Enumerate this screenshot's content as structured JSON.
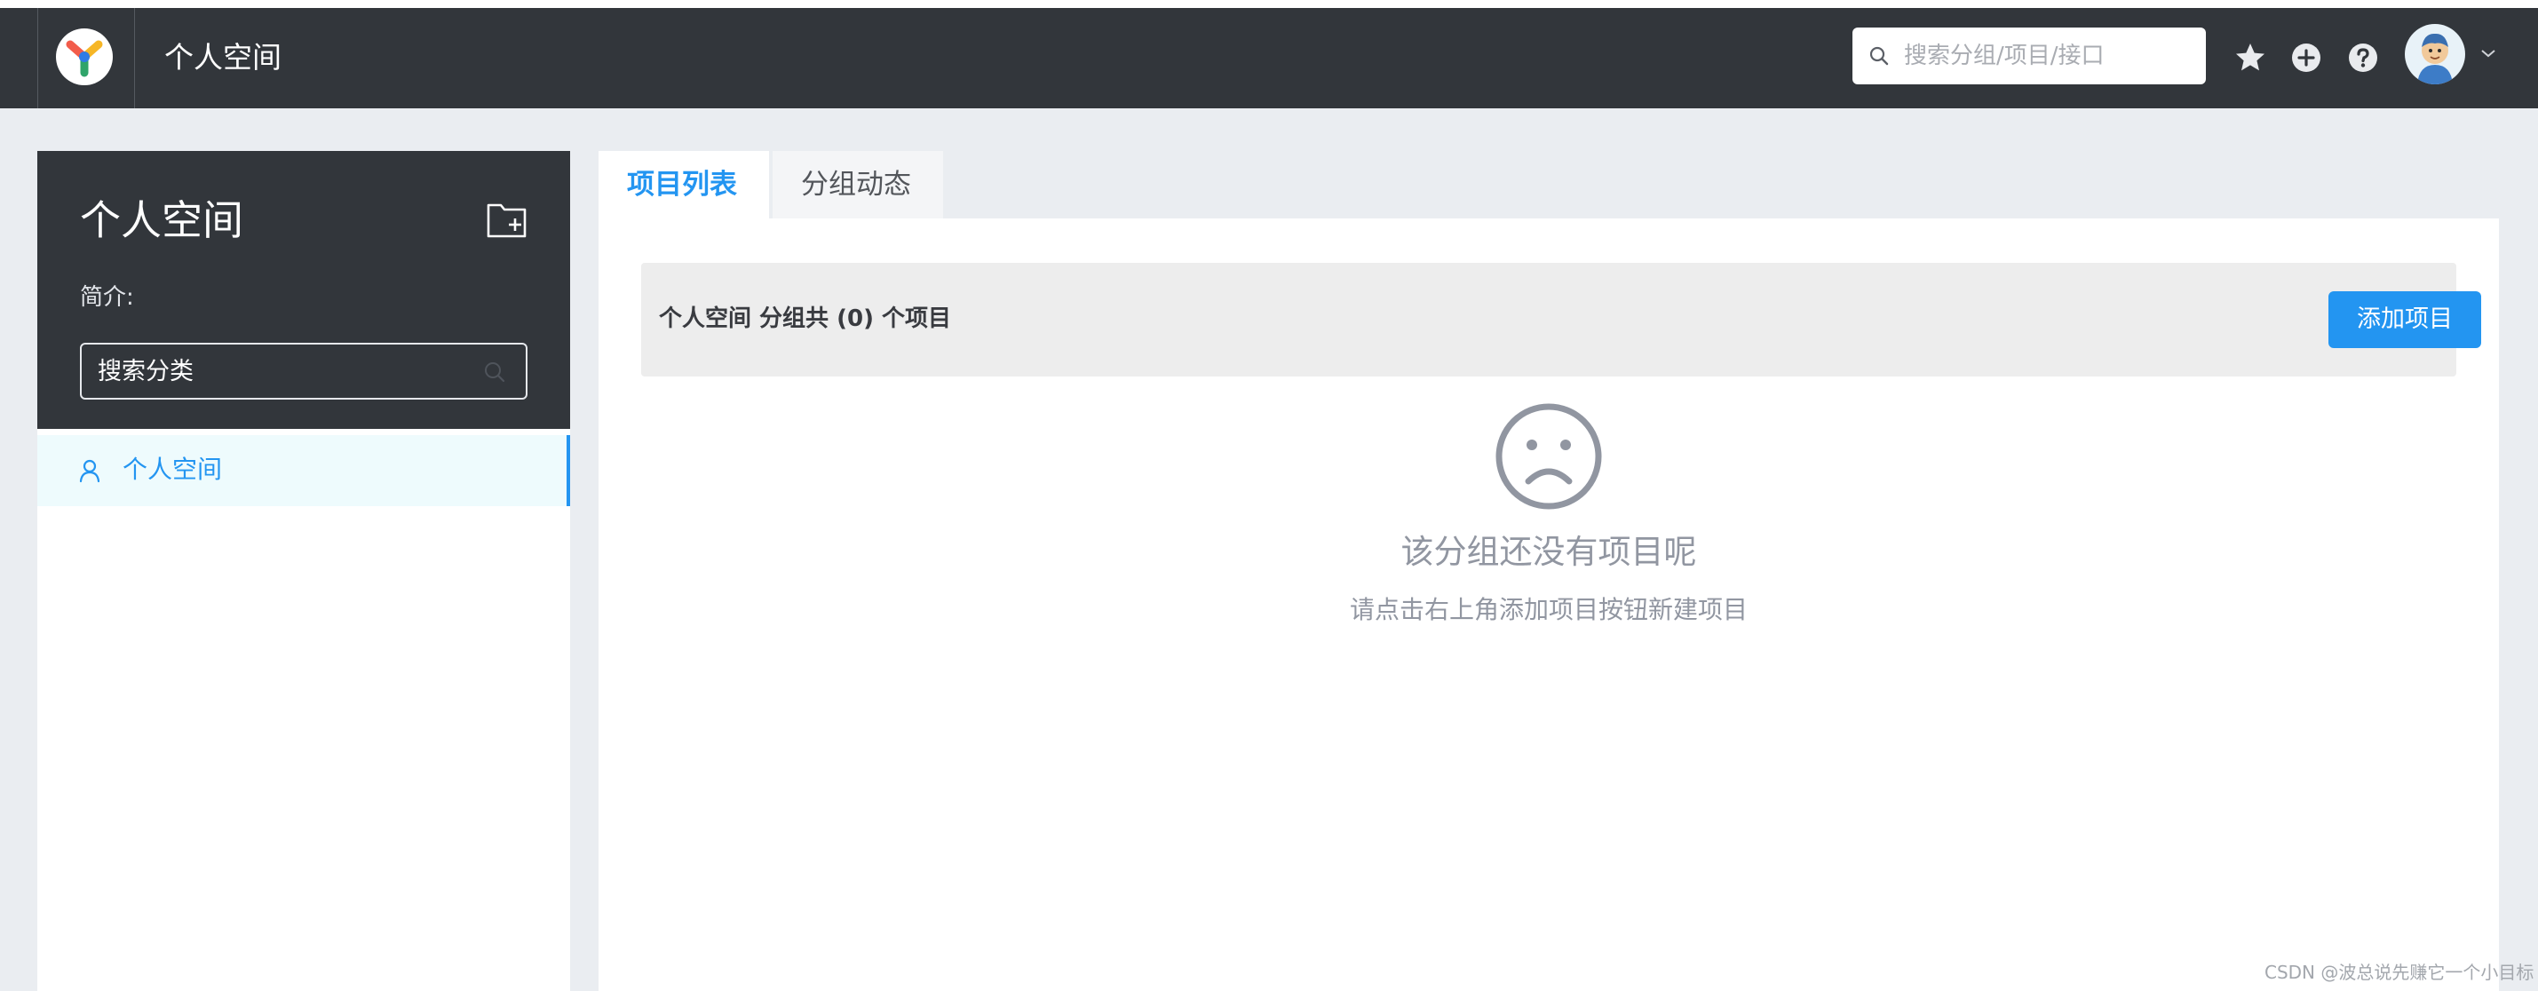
{
  "header": {
    "title": "个人空间",
    "search_placeholder": "搜索分组/项目/接口",
    "icons": [
      "star-icon",
      "plus-circle-icon",
      "help-circle-icon",
      "user-avatar",
      "chevron-down-icon"
    ]
  },
  "sidebar": {
    "title": "个人空间",
    "intro_label": "简介:",
    "category_search": "搜索分类",
    "items": [
      {
        "label": "个人空间",
        "icon": "user-icon",
        "active": true
      }
    ]
  },
  "tabs": [
    {
      "label": "项目列表",
      "active": true
    },
    {
      "label": "分组动态",
      "active": false
    }
  ],
  "project_list": {
    "summary": "个人空间 分组共 (0) 个项目",
    "add_button": "添加项目",
    "empty_title": "该分组还没有项目呢",
    "empty_subtitle": "请点击右上角添加项目按钮新建项目"
  },
  "watermark": "CSDN @波总说先赚它一个小目标",
  "colors": {
    "header_bg": "#32363b",
    "accent": "#2395f1",
    "page_bg": "#eaedf1",
    "muted_text": "#9196a1"
  }
}
